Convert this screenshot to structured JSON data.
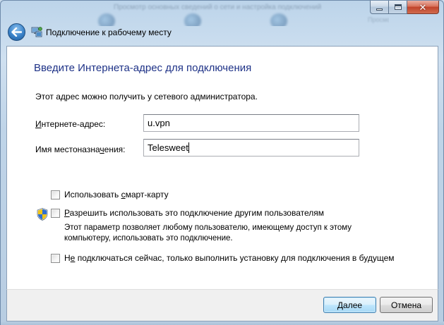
{
  "window": {
    "title": "Подключение к рабочему месту",
    "background_text": "Просмотр основных сведений о сети и настройка подключений",
    "background_text2": "Просмотр полной карты",
    "buttons": {
      "minimize": "–",
      "maximize": "□",
      "close": "✕"
    }
  },
  "wizard": {
    "heading": "Введите Интернета-адрес для подключения",
    "intro": "Этот адрес можно получить у сетевого администратора.",
    "address_label_key": "И",
    "address_label_rest": "нтернете-адрес:",
    "address_value": "u.vpn",
    "dest_label_start": "Имя местоназна",
    "dest_label_key": "ч",
    "dest_label_end": "ения:",
    "dest_value": "Telesweet",
    "smartcard_start": "Использовать ",
    "smartcard_key": "с",
    "smartcard_end": "март-карту",
    "smartcard_checked": false,
    "allow_key": "Р",
    "allow_rest": "азрешить использовать это подключение другим пользователям",
    "allow_checked": false,
    "allow_note": "Этот параметр позволяет любому пользователю, имеющему доступ к этому компьютеру, использовать это подключение.",
    "noconnect_start": "Н",
    "noconnect_key": "е",
    "noconnect_end": " подключаться сейчас, только выполнить установку для подключения в будущем",
    "noconnect_checked": false
  },
  "footer": {
    "next_key": "Д",
    "next_rest": "алее",
    "cancel": "Отмена"
  },
  "icons": [
    "back-arrow-icon",
    "network-connection-icon",
    "uac-shield-icon"
  ],
  "colors": {
    "heading": "#1e3287",
    "frame": "#bcd4ea",
    "next_button": "#bee6fd"
  }
}
